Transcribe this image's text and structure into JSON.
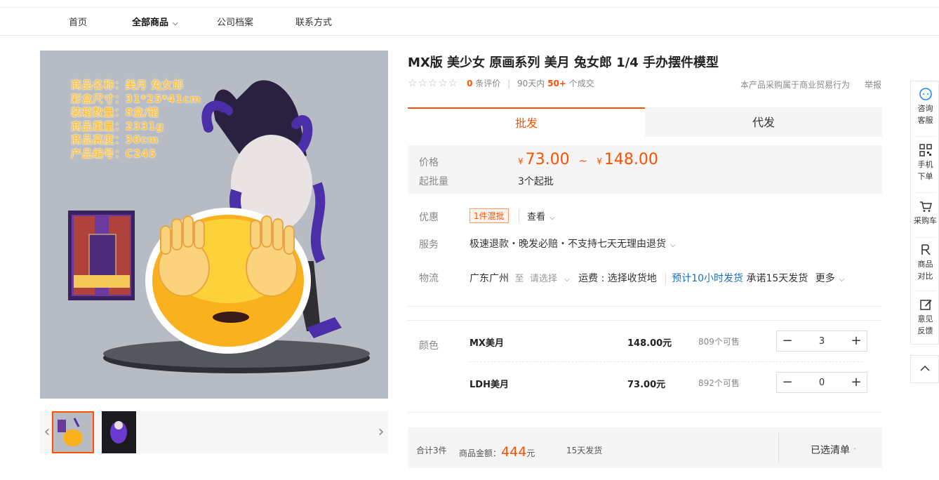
{
  "nav": {
    "items": [
      "首页",
      "全部商品",
      "公司档案",
      "联系方式"
    ],
    "active_chevron": "chevron-down-icon"
  },
  "gallery": {
    "info_lines": [
      "商品名称：美月 兔女郎",
      "彩盒尺寸：31*25*41cm",
      "装箱数量：8盒/箱",
      "商品重量：2331g",
      "商品高度：30cm",
      "产品编号：C245"
    ],
    "prev_icon": "chevron-left-icon",
    "next_icon": "chevron-right-icon"
  },
  "product": {
    "title": "MX版 美少女 原画系列 美月 兔女郎 1/4 手办摆件模型",
    "rating_count": "0",
    "rating_label": "条评价",
    "recent_label": "90天内",
    "recent_count": "50+",
    "recent_suffix": "个成交",
    "trade_note": "本产品采购属于商业贸易行为",
    "report": "举报"
  },
  "tabs": {
    "wholesale": "批发",
    "dropship": "代发"
  },
  "pricing": {
    "price_label": "价格",
    "currency": "¥",
    "price_low": "73.00",
    "tilde": "~",
    "price_high": "148.00",
    "moq_label": "起批量",
    "moq_value": "3个起批"
  },
  "promo": {
    "label": "优惠",
    "badge": "1件混批",
    "view": "查看"
  },
  "service": {
    "label": "服务",
    "text": "极速退款・晚发必赔・不支持七天无理由退货"
  },
  "logistics": {
    "label": "物流",
    "origin": "广东广州",
    "to": "至",
    "select": "请选择",
    "freight": "运费 : 选择收货地",
    "ship_time": "预计10小时发货",
    "promise": "承诺15天发货",
    "more": "更多"
  },
  "sku": {
    "color_label": "颜色",
    "rows": [
      {
        "name": "MX美月",
        "price": "148.00元",
        "stock": "809个可售",
        "qty": "3"
      },
      {
        "name": "LDH美月",
        "price": "73.00元",
        "stock": "892个可售",
        "qty": "0"
      }
    ]
  },
  "summary": {
    "total_items": "合计3件",
    "amount_label": "商品金额：",
    "amount": "444",
    "amount_unit": "元",
    "ship": "15天发货",
    "cart_list": "已选清单"
  },
  "sidebar": {
    "items": [
      "咨询客服",
      "手机下单",
      "采购车",
      "商品对比",
      "意见反馈"
    ]
  },
  "colors": {
    "accent": "#ff5000",
    "link_blue": "#1a6fc4"
  }
}
